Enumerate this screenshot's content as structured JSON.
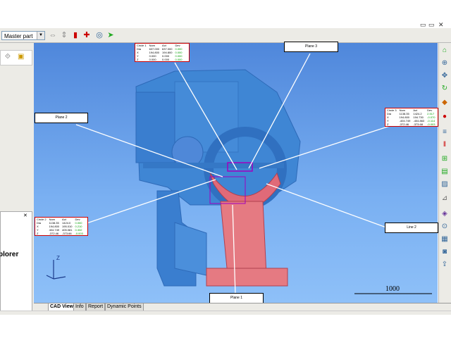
{
  "toolbar": {
    "dropdown_value": "Master part"
  },
  "explorer": {
    "title": "plorer"
  },
  "tabs": [
    "CAD View",
    "Info",
    "Report",
    "Dynamic Points"
  ],
  "viewport": {
    "scale_label": "1000",
    "labels": {
      "plane1": "Plane 1",
      "plane2": "Plane 2",
      "plane3": "Plane 3",
      "line2": "Line 2"
    },
    "tables": {
      "top": {
        "title": "Circle 1",
        "headers": [
          "Nom",
          "Act",
          "Dev"
        ],
        "rows": [
          [
            "Dia",
            "637.000",
            "637.000",
            "0.000"
          ],
          [
            "X",
            "194.800",
            "194.800",
            "0.000"
          ],
          [
            "Y",
            "0.000",
            "0.000",
            "0.000"
          ],
          [
            "Z",
            "0.000",
            "0.000",
            "0.000"
          ]
        ]
      },
      "right": {
        "title": "Circle 3",
        "headers": [
          "Nom",
          "Act",
          "Dev"
        ],
        "rows": [
          [
            "Dia",
            "1138.35",
            "1424.2",
            "2.517"
          ],
          [
            "X",
            "194.800",
            "194.730",
            "-0.070"
          ],
          [
            "Y",
            "-404.749",
            "-404.863",
            "-0.114"
          ],
          [
            "Z",
            "-372.46",
            "-373.68",
            "-0.003"
          ]
        ]
      },
      "left": {
        "title": "Circle 2",
        "headers": [
          "Nom",
          "Act",
          "Dev"
        ],
        "rows": [
          [
            "Dia",
            "1138.35",
            "1424.0",
            "0.000"
          ],
          [
            "X",
            "194.800",
            "195.010",
            "0.210"
          ],
          [
            "Y",
            "404.749",
            "405.081",
            "0.332"
          ],
          [
            "Z",
            "-372.46",
            "-373.66",
            "-0.003"
          ]
        ]
      }
    }
  }
}
